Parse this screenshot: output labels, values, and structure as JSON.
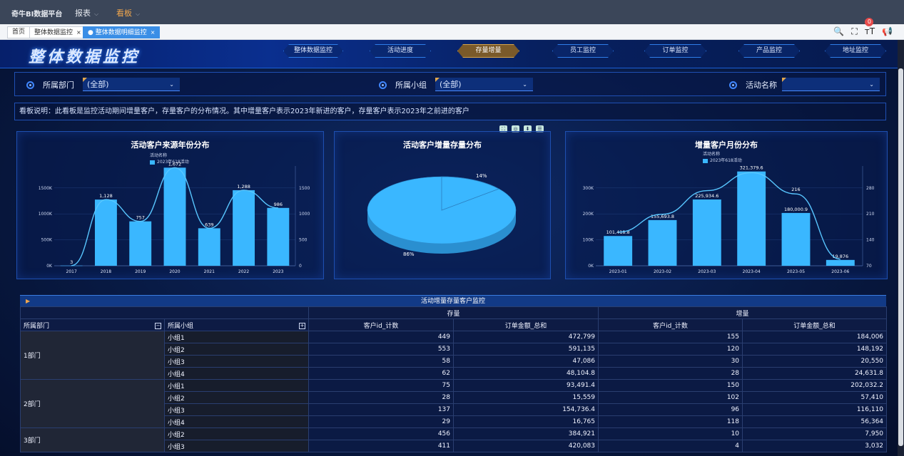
{
  "topbar": {
    "brand": "奇牛BI数据平台",
    "menus": [
      {
        "label": "报表"
      },
      {
        "label": "看板"
      }
    ]
  },
  "tabs": [
    {
      "label": "首页"
    },
    {
      "label": "整体数据监控"
    },
    {
      "label": "整体数据明细监控"
    }
  ],
  "notifications": {
    "count": "0"
  },
  "dashboard": {
    "title": "整体数据监控",
    "nav": [
      "整体数据监控",
      "活动进度",
      "存量增量",
      "员工监控",
      "订单监控",
      "产品监控",
      "地址监控"
    ],
    "active_nav": "存量增量"
  },
  "filters": [
    {
      "label": "所属部门",
      "value": "(全部)"
    },
    {
      "label": "所属小组",
      "value": "(全部)"
    },
    {
      "label": "活动名称",
      "value": ""
    }
  ],
  "description": "看板说明：此看板是监控活动期间增量客户，存量客户的分布情况。其中增量客户表示2023年新进的客户，存量客户表示2023年之前进的客户",
  "chart_data": [
    {
      "type": "bar",
      "title": "活动客户来源年份分布",
      "legend_title": "活动名称",
      "series": [
        {
          "name": "2023年618活动",
          "values": [
            3,
            1128,
            757,
            1672,
            639,
            1288,
            986
          ]
        }
      ],
      "categories": [
        "2017",
        "2018",
        "2019",
        "2020",
        "2021",
        "2022",
        "2023"
      ],
      "data_labels": [
        "3",
        "1,128",
        "757",
        "1,672",
        "639",
        "1,288",
        "986"
      ],
      "left_axis_ticks": [
        "0K",
        "500K",
        "1000K",
        "1500K"
      ],
      "right_axis_ticks": [
        "0",
        "500",
        "1000",
        "1500"
      ],
      "ylim": [
        0,
        1700
      ],
      "line_overlay": true
    },
    {
      "type": "pie",
      "title": "活动客户增量存量分布",
      "slices": [
        {
          "label": "14%",
          "value": 14
        },
        {
          "label": "86%",
          "value": 86
        }
      ],
      "toolbox": [
        "fullscreen",
        "zoom",
        "download",
        "list"
      ]
    },
    {
      "type": "bar",
      "title": "增量客户月份分布",
      "legend_title": "活动名称",
      "series": [
        {
          "name": "2023年618活动",
          "values": [
            101418.8,
            155693.8,
            225934.6,
            321379.6,
            180000.9,
            19876
          ]
        }
      ],
      "line_values": [
        101,
        155,
        226,
        280,
        216,
        20
      ],
      "line_labels": [
        "",
        "",
        "",
        "",
        "216",
        ""
      ],
      "categories": [
        "2023-01",
        "2023-02",
        "2023-03",
        "2023-04",
        "2023-05",
        "2023-06"
      ],
      "data_labels": [
        "101,418.8",
        "155,693.8",
        "225,934.6",
        "321,379.6",
        "180,000.9",
        "19,876"
      ],
      "left_axis_ticks": [
        "0K",
        "100K",
        "200K",
        "300K"
      ],
      "right_axis_ticks": [
        "70",
        "140",
        "210",
        "280"
      ],
      "ylim": [
        0,
        340000
      ]
    }
  ],
  "table": {
    "title": "活动增量存量客户监控",
    "group_headers": [
      "存量",
      "增量"
    ],
    "columns": [
      "所属部门",
      "所属小组",
      "客户id_计数",
      "订单金额_总和",
      "客户id_计数",
      "订单金额_总和"
    ],
    "groups": [
      {
        "dept": "1部门",
        "rows": [
          {
            "team": "小组1",
            "v": [
              "449",
              "472,799",
              "155",
              "184,006"
            ]
          },
          {
            "team": "小组2",
            "v": [
              "553",
              "591,135",
              "120",
              "148,192"
            ]
          },
          {
            "team": "小组3",
            "v": [
              "58",
              "47,086",
              "30",
              "20,550"
            ]
          },
          {
            "team": "小组4",
            "v": [
              "62",
              "48,104.8",
              "28",
              "24,631.8"
            ]
          }
        ]
      },
      {
        "dept": "2部门",
        "rows": [
          {
            "team": "小组1",
            "v": [
              "75",
              "93,491.4",
              "150",
              "202,032.2"
            ]
          },
          {
            "team": "小组2",
            "v": [
              "28",
              "15,559",
              "102",
              "57,410"
            ]
          },
          {
            "team": "小组3",
            "v": [
              "137",
              "154,736.4",
              "96",
              "116,110"
            ]
          },
          {
            "team": "小组4",
            "v": [
              "29",
              "16,765",
              "118",
              "56,364"
            ]
          }
        ]
      },
      {
        "dept": "3部门",
        "rows": [
          {
            "team": "小组2",
            "v": [
              "456",
              "384,921",
              "10",
              "7,950"
            ]
          },
          {
            "team": "小组3",
            "v": [
              "411",
              "420,083",
              "4",
              "3,032"
            ]
          }
        ]
      }
    ]
  }
}
